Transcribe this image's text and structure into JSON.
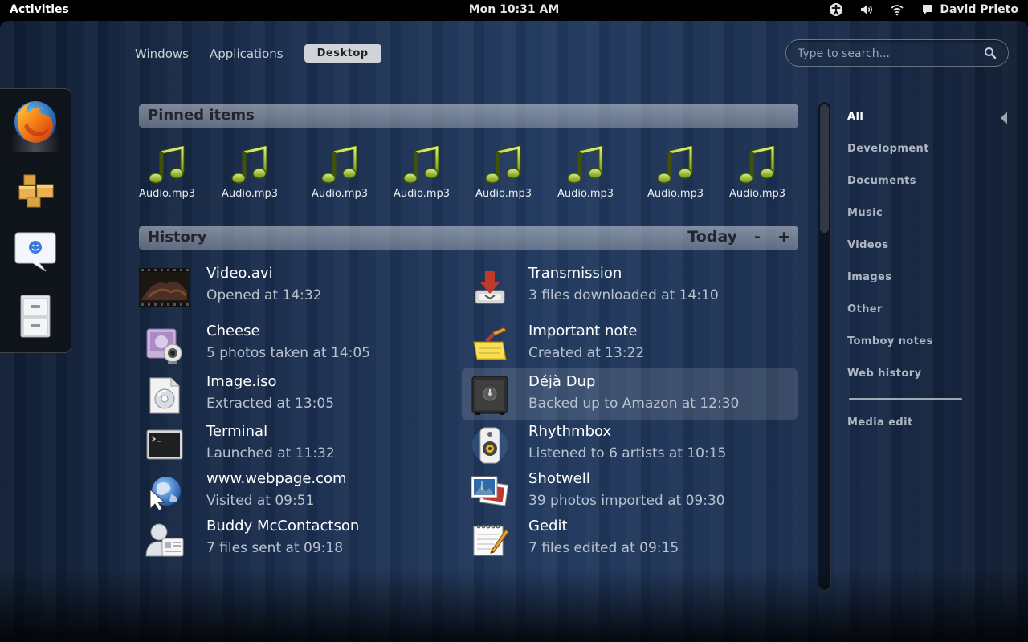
{
  "top_panel": {
    "activities": "Activities",
    "clock": "Mon 10:31 AM",
    "user_name": "David Prieto",
    "icons": [
      "accessibility-icon",
      "volume-icon",
      "wifi-icon",
      "chat-icon"
    ]
  },
  "views": {
    "windows": "Windows",
    "applications": "Applications",
    "desktop": "Desktop",
    "active": "Desktop"
  },
  "search": {
    "placeholder": "Type to search..."
  },
  "dash": {
    "items": [
      "firefox",
      "file-manager",
      "empathy",
      "file-cabinet"
    ],
    "running": "firefox"
  },
  "pinned": {
    "header": "Pinned items",
    "items": [
      {
        "label": "Audio.mp3",
        "icon": "music-note-icon"
      },
      {
        "label": "Audio.mp3",
        "icon": "music-note-icon"
      },
      {
        "label": "Audio.mp3",
        "icon": "music-note-icon"
      },
      {
        "label": "Audio.mp3",
        "icon": "music-note-icon"
      },
      {
        "label": "Audio.mp3",
        "icon": "music-note-icon"
      },
      {
        "label": "Audio.mp3",
        "icon": "music-note-icon"
      },
      {
        "label": "Audio.mp3",
        "icon": "music-note-icon"
      },
      {
        "label": "Audio.mp3",
        "icon": "music-note-icon"
      }
    ]
  },
  "history": {
    "header": "History",
    "period": "Today",
    "minus": "-",
    "plus": "+",
    "items": [
      {
        "title": "Video.avi",
        "subtitle": "Opened at 14:32",
        "icon": "video-thumbnail-icon"
      },
      {
        "title": "Transmission",
        "subtitle": "3 files downloaded at 14:10",
        "icon": "transmission-icon"
      },
      {
        "title": "Cheese",
        "subtitle": "5 photos taken at 14:05",
        "icon": "cheese-icon"
      },
      {
        "title": "Important note",
        "subtitle": "Created at 13:22",
        "icon": "note-icon"
      },
      {
        "title": "Image.iso",
        "subtitle": "Extracted at 13:05",
        "icon": "disc-image-icon"
      },
      {
        "title": "Déjà Dup",
        "subtitle": "Backed up to Amazon at 12:30",
        "icon": "safe-icon"
      },
      {
        "title": "Terminal",
        "subtitle": "Launched at 11:32",
        "icon": "terminal-icon"
      },
      {
        "title": "Rhythmbox",
        "subtitle": "Listened to 6 artists at 10:15",
        "icon": "rhythmbox-icon"
      },
      {
        "title": "www.webpage.com",
        "subtitle": "Visited at 09:51",
        "icon": "web-globe-icon"
      },
      {
        "title": "Shotwell",
        "subtitle": "39 photos imported at 09:30",
        "icon": "shotwell-icon"
      },
      {
        "title": "Buddy McContactson",
        "subtitle": "7 files sent at 09:18",
        "icon": "contact-icon"
      },
      {
        "title": "Gedit",
        "subtitle": "7 files edited at 09:15",
        "icon": "gedit-icon"
      }
    ],
    "selected": "Déjà Dup"
  },
  "categories": {
    "items": [
      "All",
      "Development",
      "Documents",
      "Music",
      "Videos",
      "Images",
      "Other",
      "Tomboy notes",
      "Web history"
    ],
    "extra": "Media edit",
    "active": "All"
  },
  "colors": {
    "panel_bg": "#000000",
    "section_header_text": "#21262e",
    "subtitle_text": "#b9c2cf",
    "desktop_tab_bg": "#d0d3d7"
  }
}
